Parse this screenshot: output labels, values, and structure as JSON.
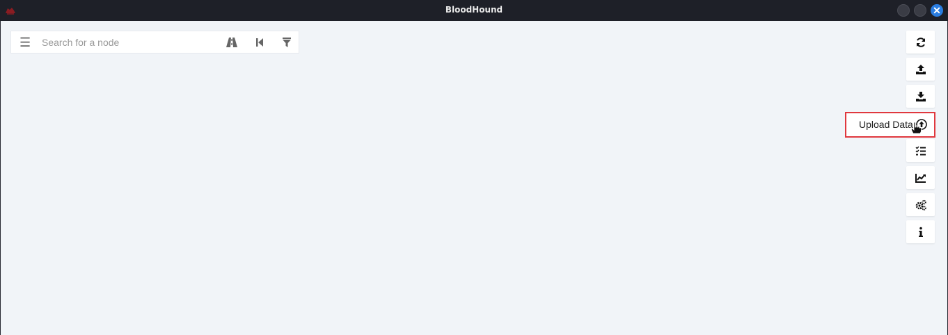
{
  "window": {
    "title": "BloodHound",
    "logo_icon": "bloodhound-logo-icon",
    "controls": [
      "minimize",
      "maximize",
      "close"
    ],
    "close_glyph": "✕",
    "accent_color": "#2a7de1"
  },
  "search": {
    "placeholder": "Search for a node",
    "value": "",
    "icons": [
      "menu-icon",
      "pathfinding-road-icon",
      "back-icon",
      "filter-icon"
    ]
  },
  "toolbar": {
    "buttons": [
      {
        "name": "refresh",
        "icon": "refresh-icon"
      },
      {
        "name": "export-graph",
        "icon": "upload-tray-icon"
      },
      {
        "name": "import-graph",
        "icon": "download-tray-icon"
      },
      {
        "name": "upload-data",
        "icon": "circle-arrow-up-icon",
        "label": "Upload Data",
        "expanded": true
      },
      {
        "name": "queries",
        "icon": "checklist-icon"
      },
      {
        "name": "database-info",
        "icon": "line-chart-icon"
      },
      {
        "name": "settings",
        "icon": "gears-icon"
      },
      {
        "name": "about",
        "icon": "info-icon"
      }
    ],
    "upload_label": "Upload Data",
    "highlight_color": "#e0383e"
  }
}
